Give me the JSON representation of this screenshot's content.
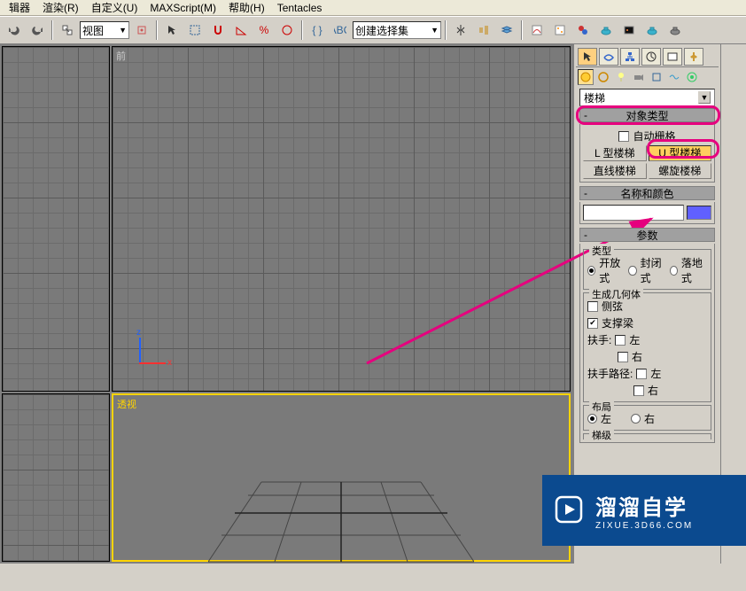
{
  "menu": {
    "m1": "辑器",
    "m2": "渲染(R)",
    "m3": "自定义(U)",
    "m4": "MAXScript(M)",
    "m5": "帮助(H)",
    "m6": "Tentacles"
  },
  "toolbar": {
    "view_label": "视图",
    "selset_label": "创建选择集"
  },
  "viewport": {
    "front": "前",
    "persp": "透视",
    "axis_z": "z",
    "axis_x": "x"
  },
  "panel": {
    "category": "楼梯",
    "rollout_objtype": "对象类型",
    "autogrid": "自动栅格",
    "btn_L": "L 型楼梯",
    "btn_U": "U 型楼梯",
    "btn_straight": "直线楼梯",
    "btn_spiral": "螺旋楼梯",
    "rollout_namecolor": "名称和颜色",
    "rollout_params": "参数",
    "grp_type": "类型",
    "type_open": "开放式",
    "type_closed": "封闭式",
    "type_box": "落地式",
    "grp_gengeom": "生成几何体",
    "chk_stringers": "侧弦",
    "chk_carriage": "支撑梁",
    "lbl_handrail": "扶手:",
    "lbl_left": "左",
    "lbl_right": "右",
    "lbl_railpath": "扶手路径:",
    "grp_layout": "布局",
    "rollout_steps": "梯级"
  },
  "watermark": {
    "big": "溜溜自学",
    "small": "ZIXUE.3D66.COM"
  }
}
